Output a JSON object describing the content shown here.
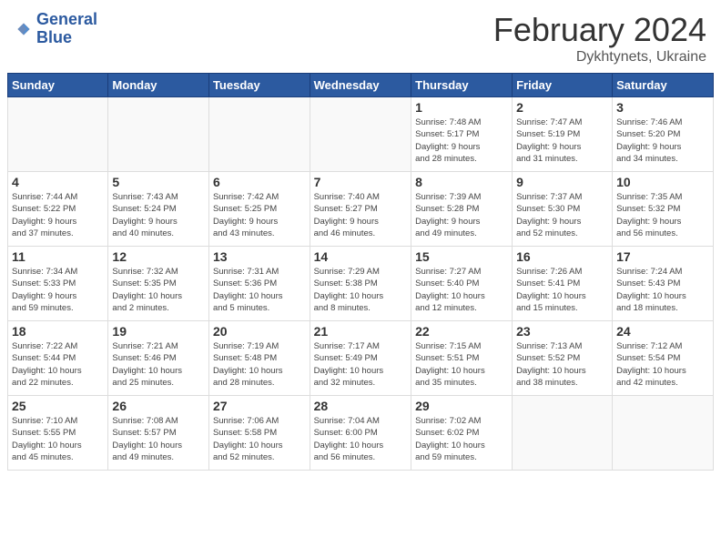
{
  "header": {
    "logo_line1": "General",
    "logo_line2": "Blue",
    "title": "February 2024",
    "subtitle": "Dykhtynets, Ukraine"
  },
  "weekdays": [
    "Sunday",
    "Monday",
    "Tuesday",
    "Wednesday",
    "Thursday",
    "Friday",
    "Saturday"
  ],
  "weeks": [
    [
      {
        "day": "",
        "info": ""
      },
      {
        "day": "",
        "info": ""
      },
      {
        "day": "",
        "info": ""
      },
      {
        "day": "",
        "info": ""
      },
      {
        "day": "1",
        "info": "Sunrise: 7:48 AM\nSunset: 5:17 PM\nDaylight: 9 hours\nand 28 minutes."
      },
      {
        "day": "2",
        "info": "Sunrise: 7:47 AM\nSunset: 5:19 PM\nDaylight: 9 hours\nand 31 minutes."
      },
      {
        "day": "3",
        "info": "Sunrise: 7:46 AM\nSunset: 5:20 PM\nDaylight: 9 hours\nand 34 minutes."
      }
    ],
    [
      {
        "day": "4",
        "info": "Sunrise: 7:44 AM\nSunset: 5:22 PM\nDaylight: 9 hours\nand 37 minutes."
      },
      {
        "day": "5",
        "info": "Sunrise: 7:43 AM\nSunset: 5:24 PM\nDaylight: 9 hours\nand 40 minutes."
      },
      {
        "day": "6",
        "info": "Sunrise: 7:42 AM\nSunset: 5:25 PM\nDaylight: 9 hours\nand 43 minutes."
      },
      {
        "day": "7",
        "info": "Sunrise: 7:40 AM\nSunset: 5:27 PM\nDaylight: 9 hours\nand 46 minutes."
      },
      {
        "day": "8",
        "info": "Sunrise: 7:39 AM\nSunset: 5:28 PM\nDaylight: 9 hours\nand 49 minutes."
      },
      {
        "day": "9",
        "info": "Sunrise: 7:37 AM\nSunset: 5:30 PM\nDaylight: 9 hours\nand 52 minutes."
      },
      {
        "day": "10",
        "info": "Sunrise: 7:35 AM\nSunset: 5:32 PM\nDaylight: 9 hours\nand 56 minutes."
      }
    ],
    [
      {
        "day": "11",
        "info": "Sunrise: 7:34 AM\nSunset: 5:33 PM\nDaylight: 9 hours\nand 59 minutes."
      },
      {
        "day": "12",
        "info": "Sunrise: 7:32 AM\nSunset: 5:35 PM\nDaylight: 10 hours\nand 2 minutes."
      },
      {
        "day": "13",
        "info": "Sunrise: 7:31 AM\nSunset: 5:36 PM\nDaylight: 10 hours\nand 5 minutes."
      },
      {
        "day": "14",
        "info": "Sunrise: 7:29 AM\nSunset: 5:38 PM\nDaylight: 10 hours\nand 8 minutes."
      },
      {
        "day": "15",
        "info": "Sunrise: 7:27 AM\nSunset: 5:40 PM\nDaylight: 10 hours\nand 12 minutes."
      },
      {
        "day": "16",
        "info": "Sunrise: 7:26 AM\nSunset: 5:41 PM\nDaylight: 10 hours\nand 15 minutes."
      },
      {
        "day": "17",
        "info": "Sunrise: 7:24 AM\nSunset: 5:43 PM\nDaylight: 10 hours\nand 18 minutes."
      }
    ],
    [
      {
        "day": "18",
        "info": "Sunrise: 7:22 AM\nSunset: 5:44 PM\nDaylight: 10 hours\nand 22 minutes."
      },
      {
        "day": "19",
        "info": "Sunrise: 7:21 AM\nSunset: 5:46 PM\nDaylight: 10 hours\nand 25 minutes."
      },
      {
        "day": "20",
        "info": "Sunrise: 7:19 AM\nSunset: 5:48 PM\nDaylight: 10 hours\nand 28 minutes."
      },
      {
        "day": "21",
        "info": "Sunrise: 7:17 AM\nSunset: 5:49 PM\nDaylight: 10 hours\nand 32 minutes."
      },
      {
        "day": "22",
        "info": "Sunrise: 7:15 AM\nSunset: 5:51 PM\nDaylight: 10 hours\nand 35 minutes."
      },
      {
        "day": "23",
        "info": "Sunrise: 7:13 AM\nSunset: 5:52 PM\nDaylight: 10 hours\nand 38 minutes."
      },
      {
        "day": "24",
        "info": "Sunrise: 7:12 AM\nSunset: 5:54 PM\nDaylight: 10 hours\nand 42 minutes."
      }
    ],
    [
      {
        "day": "25",
        "info": "Sunrise: 7:10 AM\nSunset: 5:55 PM\nDaylight: 10 hours\nand 45 minutes."
      },
      {
        "day": "26",
        "info": "Sunrise: 7:08 AM\nSunset: 5:57 PM\nDaylight: 10 hours\nand 49 minutes."
      },
      {
        "day": "27",
        "info": "Sunrise: 7:06 AM\nSunset: 5:58 PM\nDaylight: 10 hours\nand 52 minutes."
      },
      {
        "day": "28",
        "info": "Sunrise: 7:04 AM\nSunset: 6:00 PM\nDaylight: 10 hours\nand 56 minutes."
      },
      {
        "day": "29",
        "info": "Sunrise: 7:02 AM\nSunset: 6:02 PM\nDaylight: 10 hours\nand 59 minutes."
      },
      {
        "day": "",
        "info": ""
      },
      {
        "day": "",
        "info": ""
      }
    ]
  ]
}
